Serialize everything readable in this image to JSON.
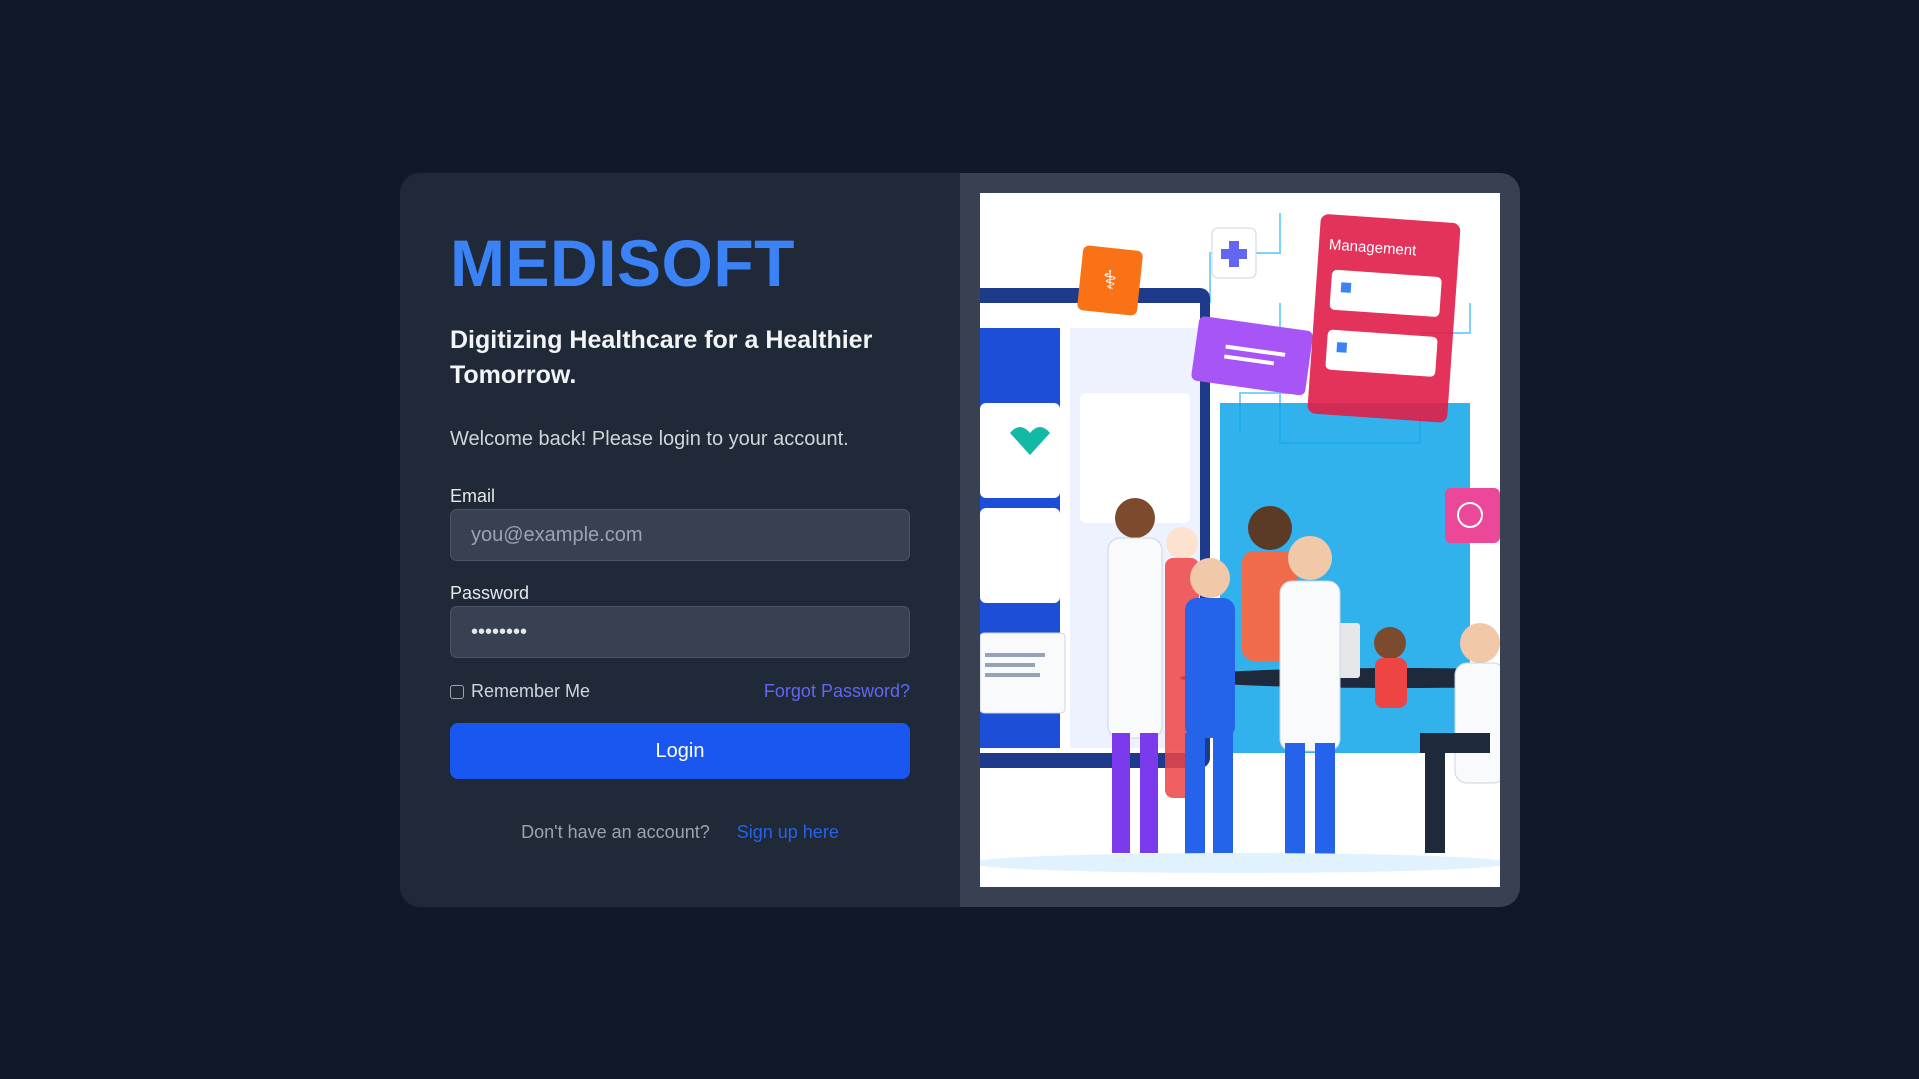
{
  "brand": {
    "name": "MEDISOFT"
  },
  "tagline": "Digitizing Healthcare for a Healthier Tomorrow.",
  "welcome": "Welcome back! Please login to your account.",
  "form": {
    "email_label": "Email",
    "email_placeholder": "you@example.com",
    "email_value": "",
    "password_label": "Password",
    "password_value": "••••••••",
    "remember_label": "Remember Me",
    "remember_checked": false,
    "forgot_label": "Forgot Password?",
    "login_label": "Login"
  },
  "signup": {
    "question": "Don't have an account?",
    "link_label": "Sign up here"
  },
  "illustration": {
    "panel_title": "Management"
  },
  "colors": {
    "background": "#111827",
    "card": "#1f2937",
    "accent": "#3b82f6",
    "button": "#1a56f0",
    "link": "#6366f1"
  }
}
